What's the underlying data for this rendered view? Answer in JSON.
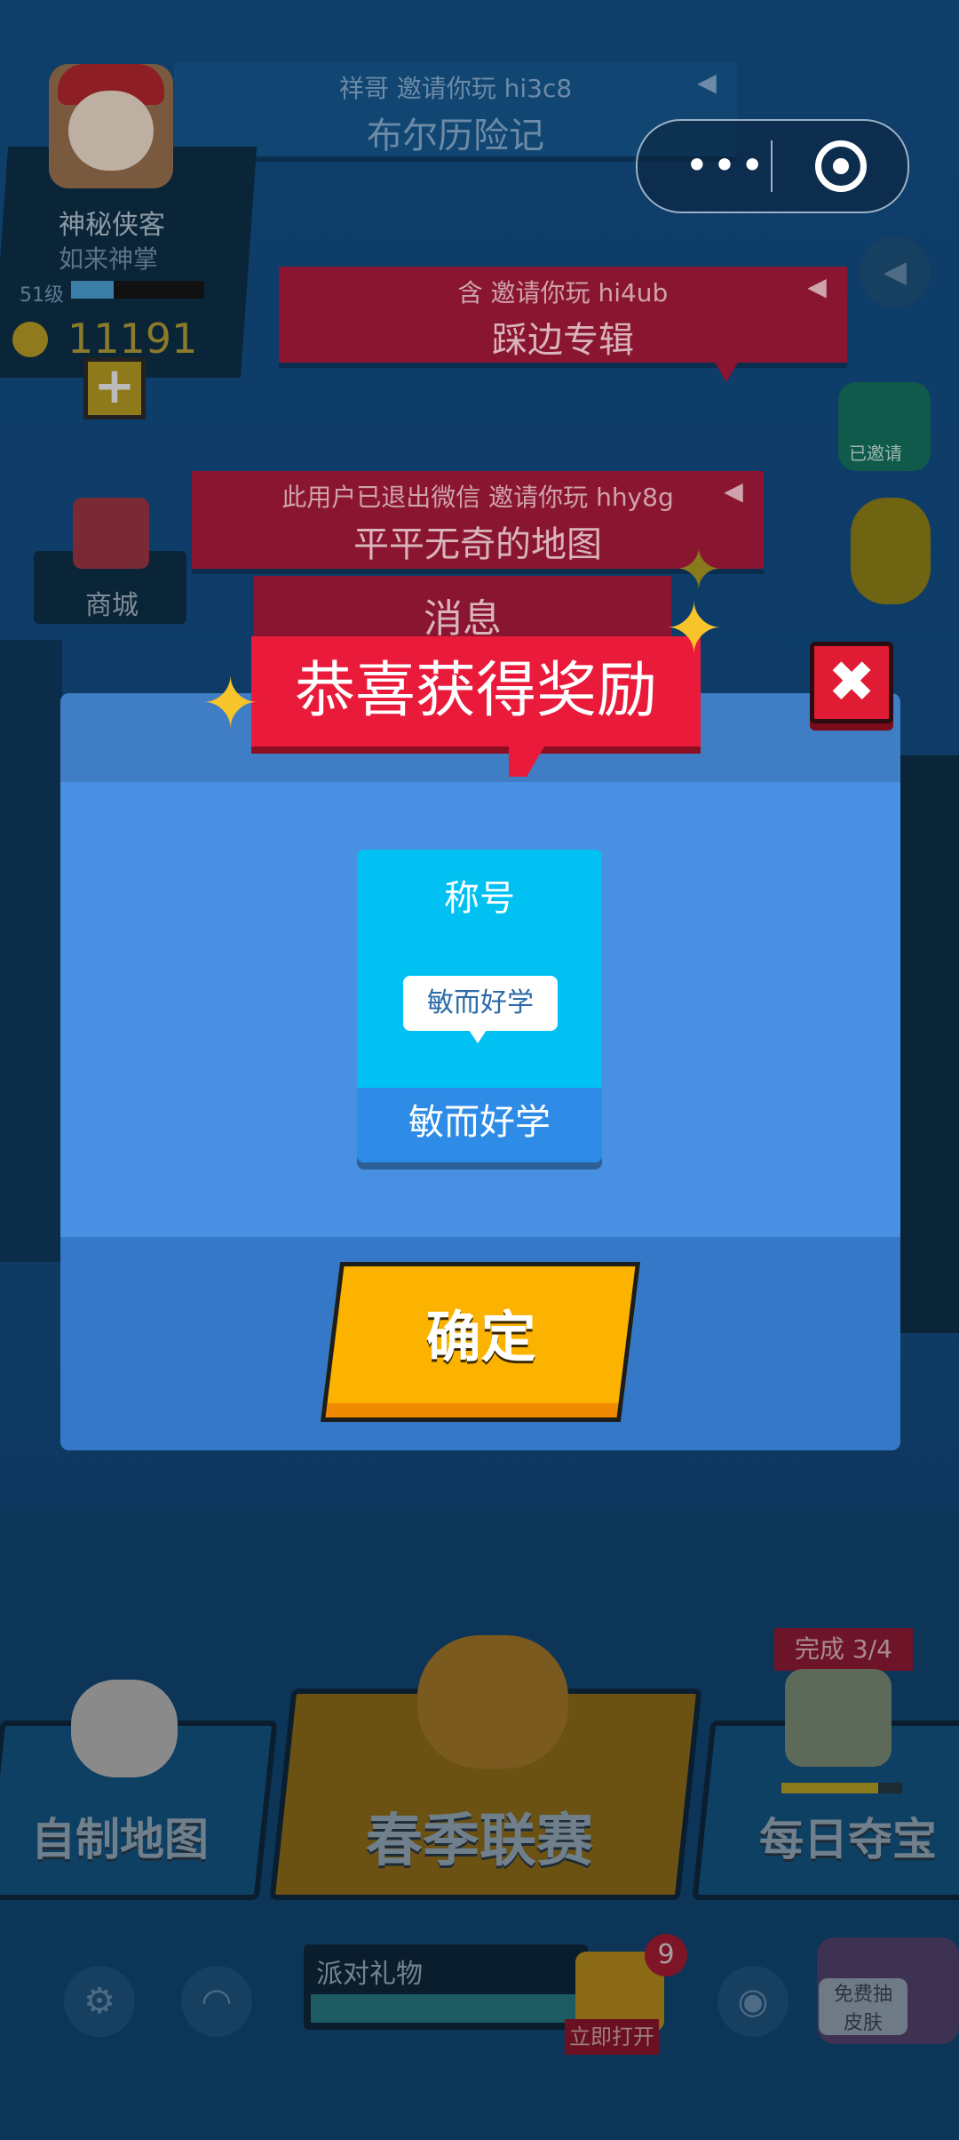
{
  "background": {
    "invites": [
      {
        "line1": "祥哥 邀请你玩 hi3c8",
        "line2": "布尔历险记"
      },
      {
        "line1": "含 邀请你玩 hi4ub",
        "line2": "踩边专辑"
      },
      {
        "line1": "此用户已退出微信 邀请你玩 hhy8g",
        "line2": "平平无奇的地图"
      }
    ],
    "partial_banner": "消息",
    "profile": {
      "name": "神秘侠客",
      "subtitle": "如来神掌",
      "level": "51级",
      "coins": "11191",
      "level_progress": 0.32
    },
    "shop_label": "商城",
    "side_badge": "已邀请",
    "modes": {
      "custom_map": "自制地图",
      "spring_league": "春季联赛",
      "daily_treasure": "每日夺宝"
    },
    "treasure_progress": "完成 3/4",
    "party_gift_label": "派对礼物",
    "gift_badge_count": "9",
    "gift_open_label": "立即打开",
    "free_skin_label_1": "免费抽",
    "free_skin_label_2": "皮肤",
    "side_text": "派"
  },
  "modal": {
    "title": "恭喜获得奖励",
    "close_glyph": "✖",
    "reward": {
      "type": "称号",
      "tag_text": "敏而好学",
      "name": "敏而好学"
    },
    "confirm_label": "确定"
  },
  "capsule": {
    "more_glyph": "•••"
  },
  "colors": {
    "title_red": "#ea1a3b",
    "modal_blue": "#4a90e2",
    "confirm_yellow": "#fbb300",
    "card_cyan": "#00c1f2"
  },
  "icons": {
    "sparkle": "✦",
    "speaker": "📢",
    "settings": "⚙",
    "headset": "🎧",
    "plus": "+"
  }
}
